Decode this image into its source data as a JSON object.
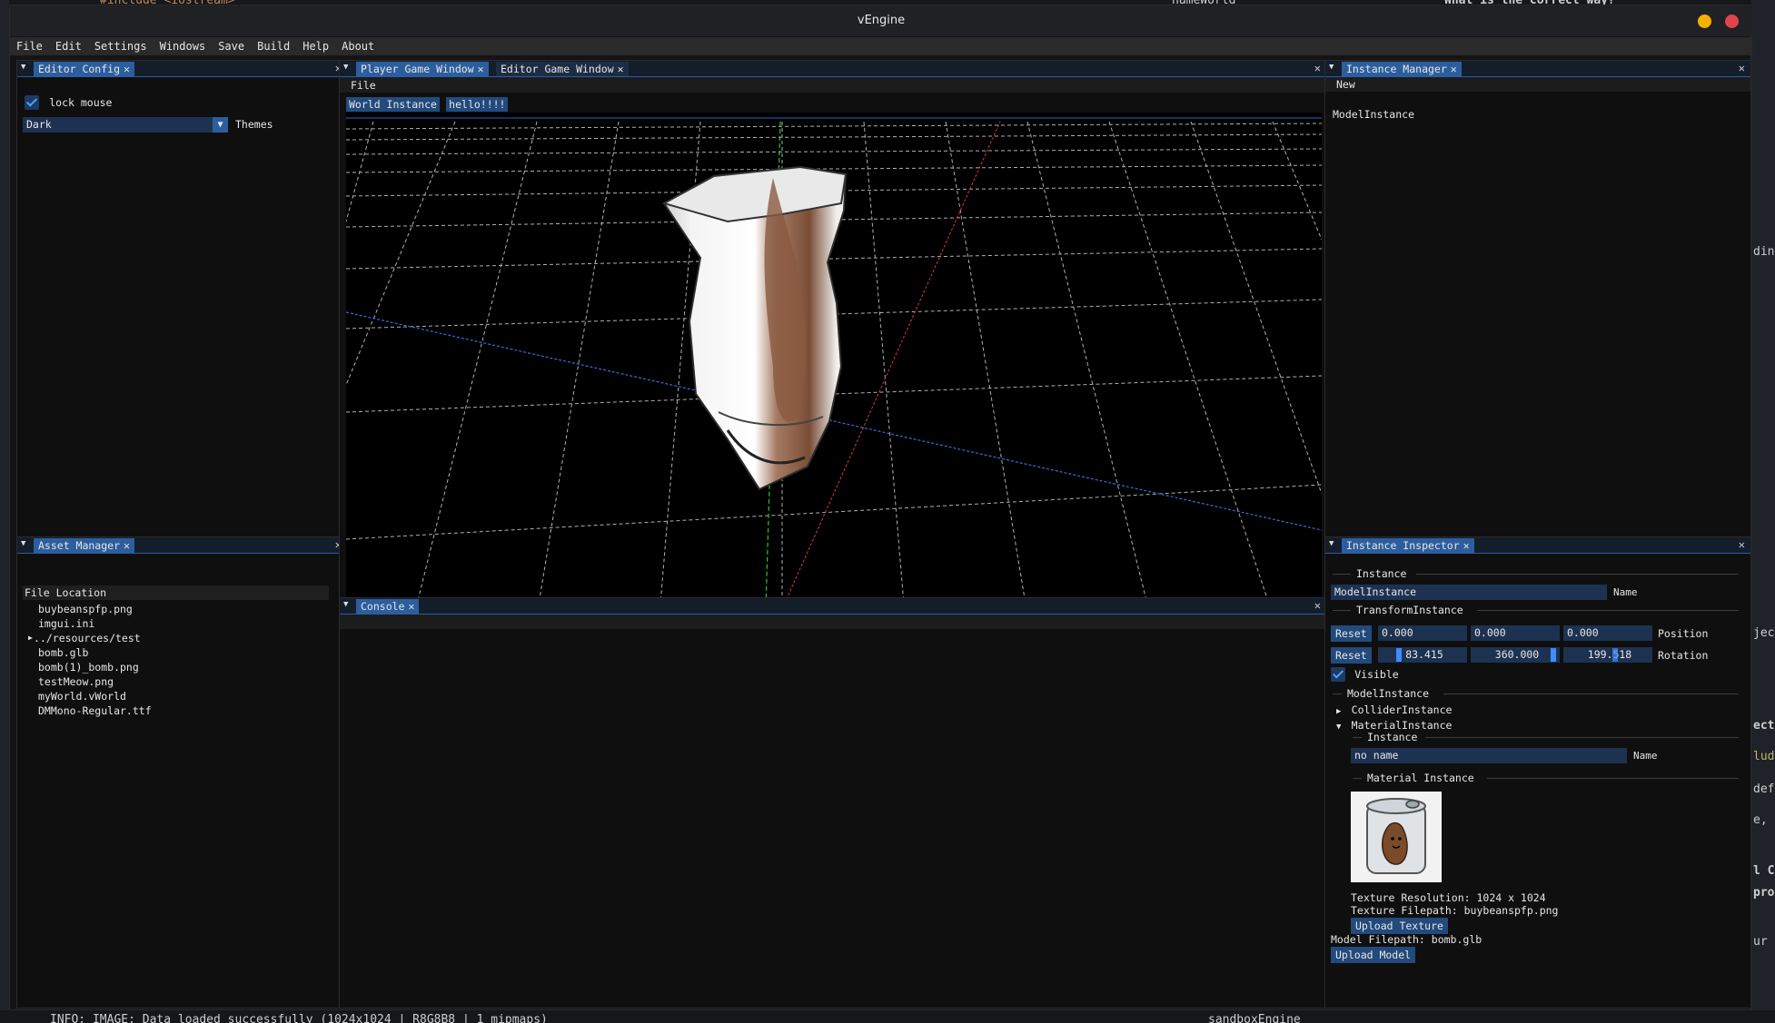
{
  "background": {
    "top_code": "#include <iostream>",
    "top_mid": "nameWorld",
    "top_right": "What is the correct way?",
    "bottom_log": "INFO: IMAGE: Data loaded successfully (1024x1024 | R8G8B8 | 1 mipmaps)",
    "bottom_right": "sandboxEngine",
    "right_snippets": [
      "ding",
      "ject",
      "ect",
      "lud",
      "defi",
      "e, re",
      "l C+",
      "pro",
      "ur c"
    ]
  },
  "window": {
    "title": "vEngine",
    "btn_minimize_color": "#f5b000",
    "btn_close_color": "#e0444a"
  },
  "menubar": [
    "File",
    "Edit",
    "Settings",
    "Windows",
    "Save",
    "Build",
    "Help",
    "About"
  ],
  "editor_config": {
    "tab": "Editor Config",
    "lock_mouse_label": "lock mouse",
    "theme_value": "Dark",
    "themes_label": "Themes"
  },
  "asset_manager": {
    "tab": "Asset Manager",
    "header": "File Location",
    "files": [
      {
        "name": "buybeanspfp.png",
        "folder": false
      },
      {
        "name": "imgui.ini",
        "folder": false
      },
      {
        "name": "../resources/test",
        "folder": true
      },
      {
        "name": "bomb.glb",
        "folder": false
      },
      {
        "name": "bomb(1)_bomb.png",
        "folder": false
      },
      {
        "name": "testMeow.png",
        "folder": false
      },
      {
        "name": "myWorld.vWorld",
        "folder": false
      },
      {
        "name": "DMMono-Regular.ttf",
        "folder": false
      }
    ]
  },
  "game_window": {
    "tabs": [
      "Player Game Window",
      "Editor Game Window"
    ],
    "menu_file": "File",
    "world_buttons": [
      "World Instance",
      "hello!!!!"
    ]
  },
  "console": {
    "tab": "Console"
  },
  "instance_manager": {
    "tab": "Instance Manager",
    "new_label": "New",
    "items": [
      "ModelInstance"
    ]
  },
  "inspector": {
    "tab": "Instance Inspector",
    "instance_section": "Instance",
    "name_value": "ModelInstance",
    "name_label": "Name",
    "transform_section": "TransformInstance",
    "reset_label": "Reset",
    "position": [
      "0.000",
      "0.000",
      "0.000"
    ],
    "position_label": "Position",
    "rotation": [
      "83.415",
      "360.000",
      "199.518"
    ],
    "rotation_label": "Rotation",
    "visible_label": "Visible",
    "model_section": "ModelInstance",
    "collider_label": "ColliderInstance",
    "material_label": "MaterialInstance",
    "sub_instance_section": "Instance",
    "material_name_value": "no name",
    "material_name_label": "Name",
    "material_section": "Material Instance",
    "texture_resolution": "Texture Resolution: 1024 x 1024",
    "texture_filepath": "Texture Filepath: buybeanspfp.png",
    "upload_texture": "Upload Texture",
    "model_filepath": "Model Filepath: bomb.glb",
    "upload_model": "Upload Model"
  }
}
